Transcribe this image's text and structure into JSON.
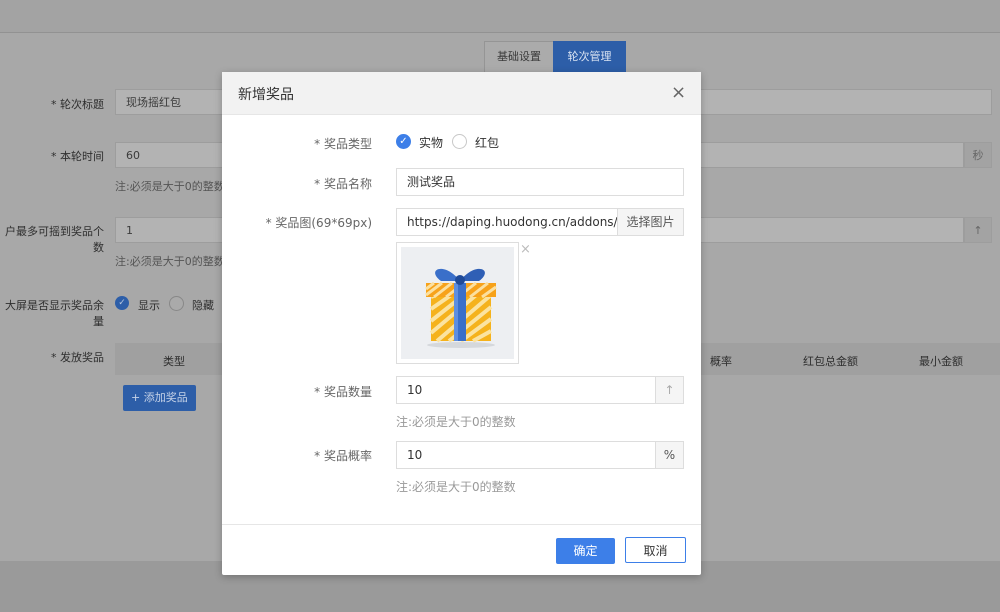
{
  "tabs": [
    {
      "label": "基础设置",
      "active": false
    },
    {
      "label": "轮次管理",
      "active": true
    }
  ],
  "form": {
    "round_title": {
      "label": "* 轮次标题",
      "value": "现场摇红包"
    },
    "round_time": {
      "label": "* 本轮时间",
      "value": "60",
      "addon": "秒",
      "note": "注:必须是大于0的整数"
    },
    "max_prizes": {
      "label": "户最多可摇到奖品个数",
      "value": "1",
      "addon": "↑",
      "note": "注:必须是大于0的整数"
    },
    "show_remaining": {
      "label": "大屏是否显示奖品余量",
      "options": [
        "显示",
        "隐藏"
      ],
      "selected": "显示"
    },
    "prizes": {
      "label": "* 发放奖品",
      "columns": [
        "类型",
        "概率",
        "红包总金额",
        "最小金额"
      ],
      "add_button": "添加奖品"
    }
  },
  "modal": {
    "title": "新增奖品",
    "close": "×",
    "prize_type": {
      "label": "* 奖品类型",
      "options": [
        "实物",
        "红包"
      ],
      "selected": "实物"
    },
    "prize_name": {
      "label": "* 奖品名称",
      "value": "测试奖品"
    },
    "prize_image": {
      "label": "* 奖品图(69*69px)",
      "value": "https://daping.huodong.cn/addons/n",
      "button": "选择图片",
      "remove": "×"
    },
    "prize_count": {
      "label": "* 奖品数量",
      "value": "10",
      "addon": "↑",
      "note": "注:必须是大于0的整数"
    },
    "prize_prob": {
      "label": "* 奖品概率",
      "value": "10",
      "addon": "%",
      "note": "注:必须是大于0的整数"
    },
    "confirm": "确定",
    "cancel": "取消"
  },
  "colors": {
    "primary": "#3d7fe8",
    "overlay": "#a8a8a8"
  }
}
